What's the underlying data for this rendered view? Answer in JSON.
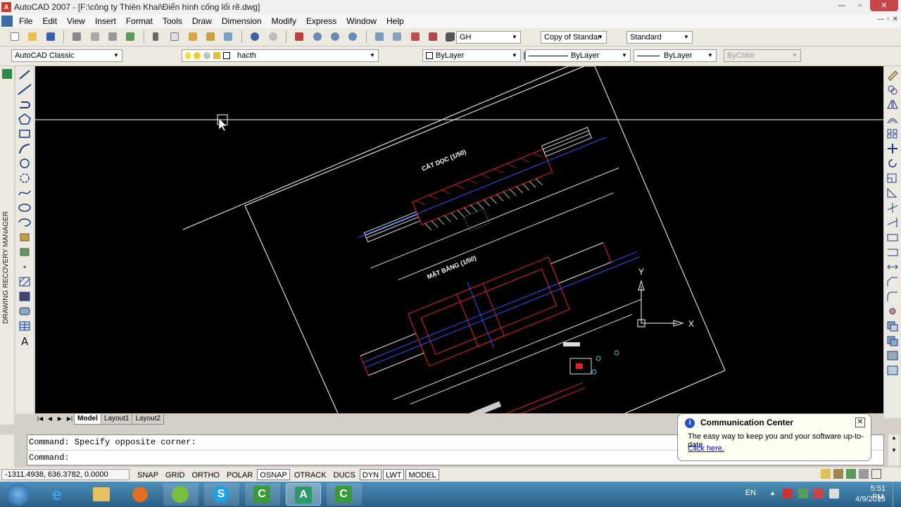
{
  "window": {
    "title": "AutoCAD 2007 - [F:\\công ty Thiên Khai\\Điển hình cống lối rẽ.dwg]",
    "min_label": "—",
    "max_label": "▫",
    "close_label": "✕"
  },
  "menu": [
    "File",
    "Edit",
    "View",
    "Insert",
    "Format",
    "Tools",
    "Draw",
    "Dimension",
    "Modify",
    "Express",
    "Window",
    "Help"
  ],
  "toolbar1": {
    "text_style": "GH",
    "dim_style": "Copy of Standar",
    "table_style": "Standard"
  },
  "toolbar2": {
    "workspace": "AutoCAD Classic",
    "layer": "hacth",
    "color": "ByLayer",
    "linetype": "ByLayer",
    "lineweight": "ByLayer",
    "plotstyle": "ByColor"
  },
  "side_panel": {
    "label": "DRAWING RECOVERY MANAGER"
  },
  "drawing": {
    "title_section": "CẮT DỌC (1/50)",
    "title_plan": "MẶT BẰNG (1/50)",
    "ucs_y": "Y",
    "ucs_x": "X"
  },
  "tabs": [
    "Model",
    "Layout1",
    "Layout2"
  ],
  "command": {
    "line1": "Command: Specify opposite corner:",
    "line2": "Command:"
  },
  "status": {
    "coords": "-1311.4938, 636.3782, 0.0000",
    "toggles": [
      {
        "label": "SNAP",
        "on": false
      },
      {
        "label": "GRID",
        "on": false
      },
      {
        "label": "ORTHO",
        "on": false
      },
      {
        "label": "POLAR",
        "on": false
      },
      {
        "label": "OSNAP",
        "on": true
      },
      {
        "label": "OTRACK",
        "on": false
      },
      {
        "label": "DUCS",
        "on": false
      },
      {
        "label": "DYN",
        "on": true
      },
      {
        "label": "LWT",
        "on": true
      },
      {
        "label": "MODEL",
        "on": true
      }
    ]
  },
  "balloon": {
    "title": "Communication Center",
    "body": "The easy way to keep you and your software up-to-date.",
    "link": "Click here."
  },
  "taskbar": {
    "lang": "EN",
    "time": "5:51 PM",
    "date": "4/9/2015"
  },
  "colors": {
    "canvas": "#000000",
    "drawing_line": "#ffffff",
    "hatch_red": "#e0202a",
    "axis_blue": "#3050ff"
  }
}
